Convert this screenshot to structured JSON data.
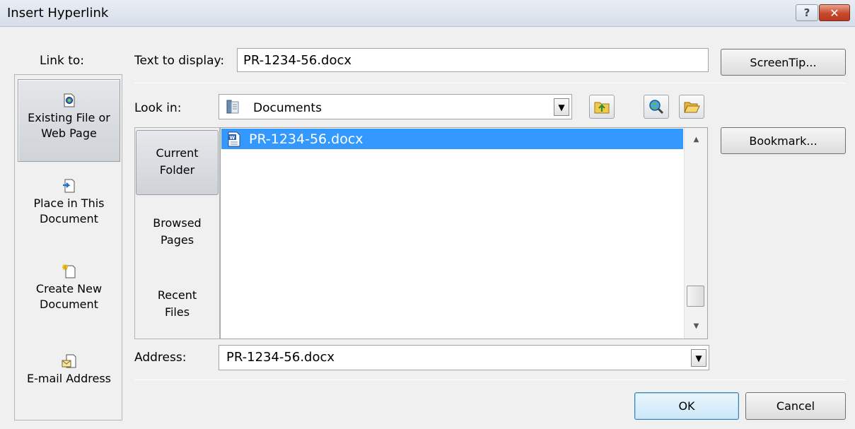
{
  "window": {
    "title": "Insert Hyperlink",
    "help_glyph": "?",
    "close_glyph": "✕"
  },
  "link_to": {
    "label": "Link to:",
    "items": [
      {
        "line1": "Existing File or",
        "line2": "Web Page",
        "icon": "existing-file-icon",
        "selected": true
      },
      {
        "line1": "Place in This",
        "line2": "Document",
        "icon": "place-in-document-icon",
        "selected": false
      },
      {
        "line1": "Create New",
        "line2": "Document",
        "icon": "create-new-document-icon",
        "selected": false
      },
      {
        "line1": "E-mail Address",
        "line2": "",
        "icon": "email-address-icon",
        "selected": false
      }
    ]
  },
  "text_to_display": {
    "label": "Text to display:",
    "value": "PR-1234-56.docx"
  },
  "look_in": {
    "label": "Look in:",
    "value": "Documents"
  },
  "folder_tabs": [
    {
      "line1": "Current",
      "line2": "Folder",
      "selected": true
    },
    {
      "line1": "Browsed",
      "line2": "Pages",
      "selected": false
    },
    {
      "line1": "Recent",
      "line2": "Files",
      "selected": false
    }
  ],
  "files": [
    {
      "name": "PR-1234-56.docx",
      "icon": "word-document-icon",
      "selected": true
    }
  ],
  "address": {
    "label": "Address:",
    "value": "PR-1234-56.docx"
  },
  "buttons": {
    "screentip": "ScreenTip...",
    "bookmark": "Bookmark...",
    "ok": "OK",
    "cancel": "Cancel"
  },
  "colors": {
    "selection": "#3399ff",
    "close_button": "#c7482a"
  }
}
